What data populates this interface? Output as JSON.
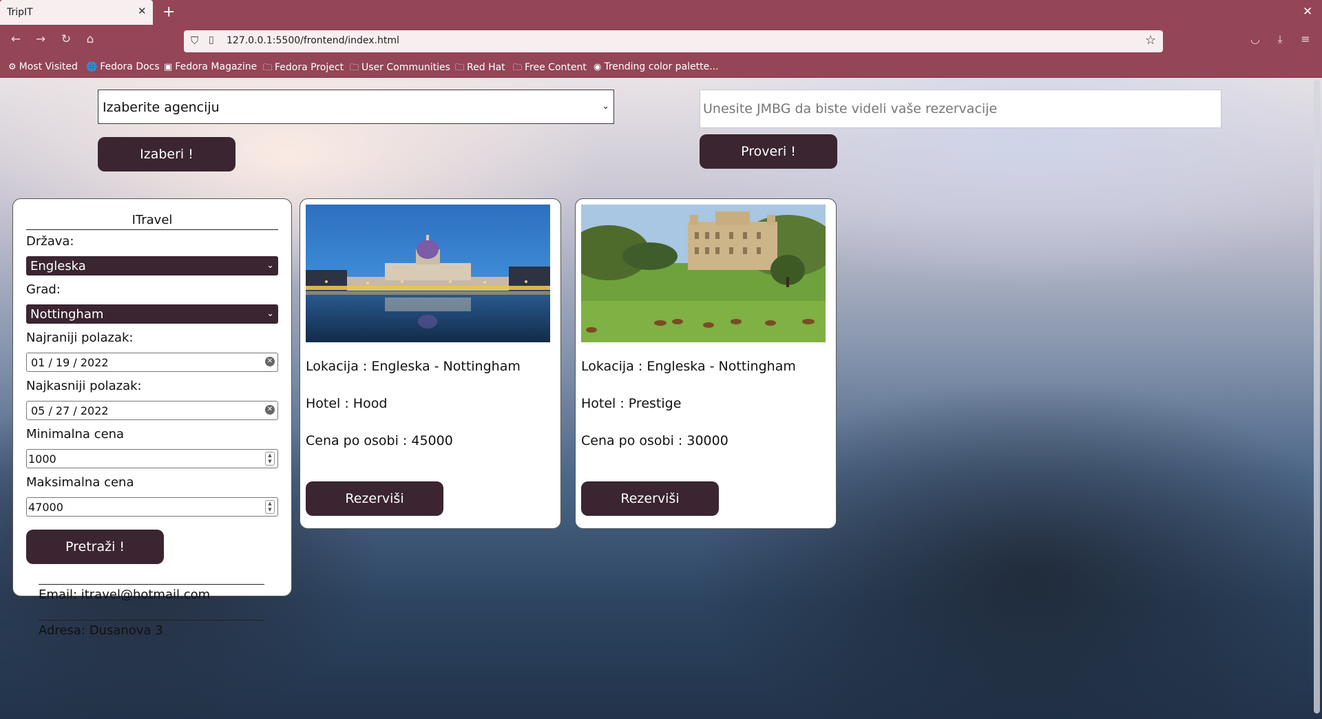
{
  "browser": {
    "tab_title": "TripIT",
    "tab_close": "✕",
    "new_tab": "+",
    "window_close": "✕",
    "url": "127.0.0.1:5500/frontend/index.html",
    "bookmarks": [
      {
        "icon": "gear-icon",
        "glyph": "⚙",
        "label": "Most Visited"
      },
      {
        "icon": "globe-icon",
        "glyph": "🌐",
        "label": "Fedora Docs"
      },
      {
        "icon": "fedora-magazine-icon",
        "glyph": "▣",
        "label": "Fedora Magazine"
      },
      {
        "icon": "folder-icon",
        "glyph": "🗀",
        "label": "Fedora Project"
      },
      {
        "icon": "folder-icon",
        "glyph": "🗀",
        "label": "User Communities"
      },
      {
        "icon": "folder-icon",
        "glyph": "🗀",
        "label": "Red Hat"
      },
      {
        "icon": "folder-icon",
        "glyph": "🗀",
        "label": "Free Content"
      },
      {
        "icon": "palette-site-icon",
        "glyph": "◉",
        "label": "Trending color palette..."
      }
    ]
  },
  "header": {
    "agency_select": "Izaberite agenciju",
    "choose_button": "Izaberi !",
    "jmbg_placeholder": "Unesite JMBG da biste videli vaše rezervacije",
    "check_button": "Proveri !"
  },
  "filter": {
    "title": "ITravel",
    "country_label": "Država:",
    "country_value": "Engleska",
    "city_label": "Grad:",
    "city_value": "Nottingham",
    "earliest_label": "Najraniji polazak:",
    "earliest_value": "01 / 19 / 2022",
    "latest_label": "Najkasniji polazak:",
    "latest_value": "05 / 27 / 2022",
    "min_price_label": "Minimalna cena",
    "min_price_value": "1000",
    "max_price_label": "Maksimalna cena",
    "max_price_value": "47000",
    "search_button": "Pretraži !",
    "email": "Email: itravel@hotmail.com",
    "address": "Adresa: Dusanova 3"
  },
  "offers": [
    {
      "location": "Lokacija : Engleska - Nottingham",
      "hotel": "Hotel : Hood",
      "price": "Cena po osobi : 45000",
      "button": "Rezerviši"
    },
    {
      "location": "Lokacija : Engleska - Nottingham",
      "hotel": "Hotel : Prestige",
      "price": "Cena po osobi : 30000",
      "button": "Rezerviši"
    }
  ]
}
